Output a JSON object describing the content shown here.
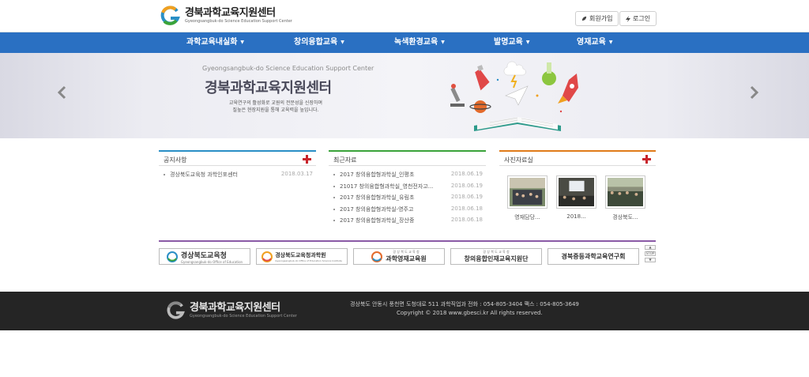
{
  "header": {
    "site_title": "경북과학교육지원센터",
    "site_subtitle": "Gyeongsangbuk-do Science Education Support Center",
    "join_label": "회원가입",
    "login_label": "로그인"
  },
  "nav": {
    "items": [
      {
        "label": "과학교육내실화"
      },
      {
        "label": "창의융합교육"
      },
      {
        "label": "녹색환경교육"
      },
      {
        "label": "발명교육"
      },
      {
        "label": "영재교육"
      }
    ],
    "caret": "▼"
  },
  "hero": {
    "subtitle": "Gyeongsangbuk-do Science Education Support Center",
    "title": "경북과학교육지원센터",
    "desc_line1": "교육연구의 활성화로 교원의 전문성을 신장하며",
    "desc_line2": "질높은 현장지원을 통해 교육력을 높입니다."
  },
  "notice": {
    "title": "공지사항",
    "items": [
      {
        "text": "경상북도교육청 과학인포센터",
        "date": "2018.03.17"
      }
    ]
  },
  "recent": {
    "title": "최근자료",
    "items": [
      {
        "text": "2017 창의융합형과학실_인평초",
        "date": "2018.06.19"
      },
      {
        "text": "21017 창의융합형과학실_영천전자고...",
        "date": "2018.06.19"
      },
      {
        "text": "2017 창의융합형과학실_유림초",
        "date": "2018.06.19"
      },
      {
        "text": "2017 창의융합형과학실-영주고",
        "date": "2018.06.18"
      },
      {
        "text": "2017 창의융합형과학실_장산중",
        "date": "2018.06.18"
      }
    ]
  },
  "photos": {
    "title": "사진자료실",
    "items": [
      {
        "caption": "영재담당..."
      },
      {
        "caption": "2018..."
      },
      {
        "caption": "경상북도..."
      }
    ]
  },
  "partners": {
    "items": [
      {
        "label": "경상북도교육청",
        "sub": "Gyeongsangbuk-do Office of Education"
      },
      {
        "label": "경상북도교육청과학원",
        "sub": "Gyeongsangbuk-do Office of Education Science Institute"
      },
      {
        "label": "과학영재교육원",
        "sub": "경 상 북 도 교 육 청"
      },
      {
        "label": "창의융합인재교육지원단",
        "sub": "경 상 북 도 교 육 청"
      },
      {
        "label": "경북중등과학교육연구회",
        "sub": ""
      }
    ],
    "stop_label": "STOP"
  },
  "footer": {
    "title": "경북과학교육지원센터",
    "subtitle": "Gyeongsangbuk-do Science Education Support Center",
    "address": "경상북도 안동시 풍천면 도청대로 511 과학직업과 전화 : 054-805-3404 팩스 : 054-805-3649",
    "copyright": "Copyright © 2018 www.gbesci.kr All rights reserved."
  },
  "colors": {
    "nav_blue": "#2a70c2",
    "notice_accent": "#2a8fc6",
    "recent_accent": "#3aa33a",
    "photo_accent": "#e07b1a",
    "plus_red": "#c8242b",
    "strip_purple": "#8a5aa6",
    "footer_bg": "#252525"
  }
}
